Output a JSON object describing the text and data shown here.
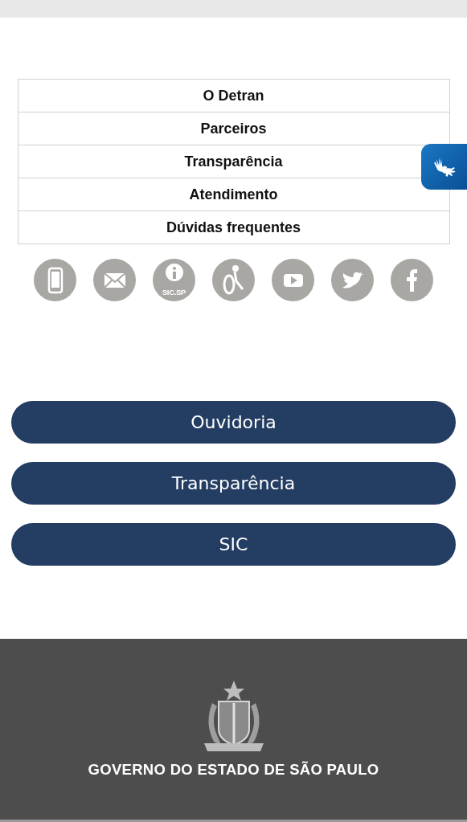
{
  "menu": [
    {
      "label": "O Detran"
    },
    {
      "label": "Parceiros"
    },
    {
      "label": "Transparência"
    },
    {
      "label": "Atendimento"
    },
    {
      "label": "Dúvidas frequentes"
    }
  ],
  "social_icons": [
    {
      "kind": "phone"
    },
    {
      "kind": "mail"
    },
    {
      "kind": "sic",
      "label": "SIC.SP"
    },
    {
      "kind": "wheelchair"
    },
    {
      "kind": "video"
    },
    {
      "kind": "bird"
    },
    {
      "kind": "f"
    }
  ],
  "buttons": [
    {
      "label": "Ouvidoria"
    },
    {
      "label": "Transparência"
    },
    {
      "label": "SIC"
    }
  ],
  "footer": {
    "text": "GOVERNO DO ESTADO DE SÃO PAULO"
  }
}
